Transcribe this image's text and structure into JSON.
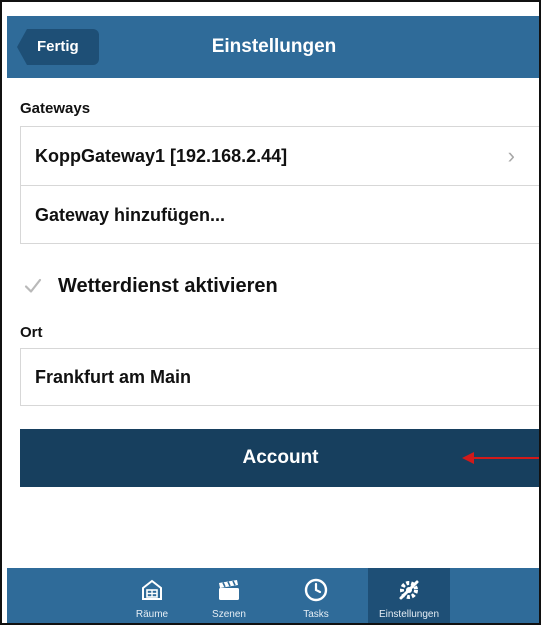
{
  "header": {
    "back_label": "Fertig",
    "title": "Einstellungen"
  },
  "gateways": {
    "section_label": "Gateways",
    "items": [
      {
        "label": "KoppGateway1 [192.168.2.44]"
      },
      {
        "label": "Gateway hinzufügen..."
      }
    ]
  },
  "weather": {
    "label": "Wetterdienst aktivieren",
    "checked": true
  },
  "location": {
    "section_label": "Ort",
    "value": "Frankfurt am Main"
  },
  "account": {
    "label": "Account"
  },
  "tabbar": {
    "tabs": [
      {
        "label": "Räume",
        "icon": "rooms-icon"
      },
      {
        "label": "Szenen",
        "icon": "clapperboard-icon"
      },
      {
        "label": "Tasks",
        "icon": "clock-icon"
      },
      {
        "label": "Einstellungen",
        "icon": "settings-icon",
        "active": true
      }
    ]
  },
  "colors": {
    "bar": "#2f6b99",
    "bar_dark": "#1e4f76",
    "account_button": "#173f5e",
    "annotation_arrow": "#d11a1a"
  }
}
